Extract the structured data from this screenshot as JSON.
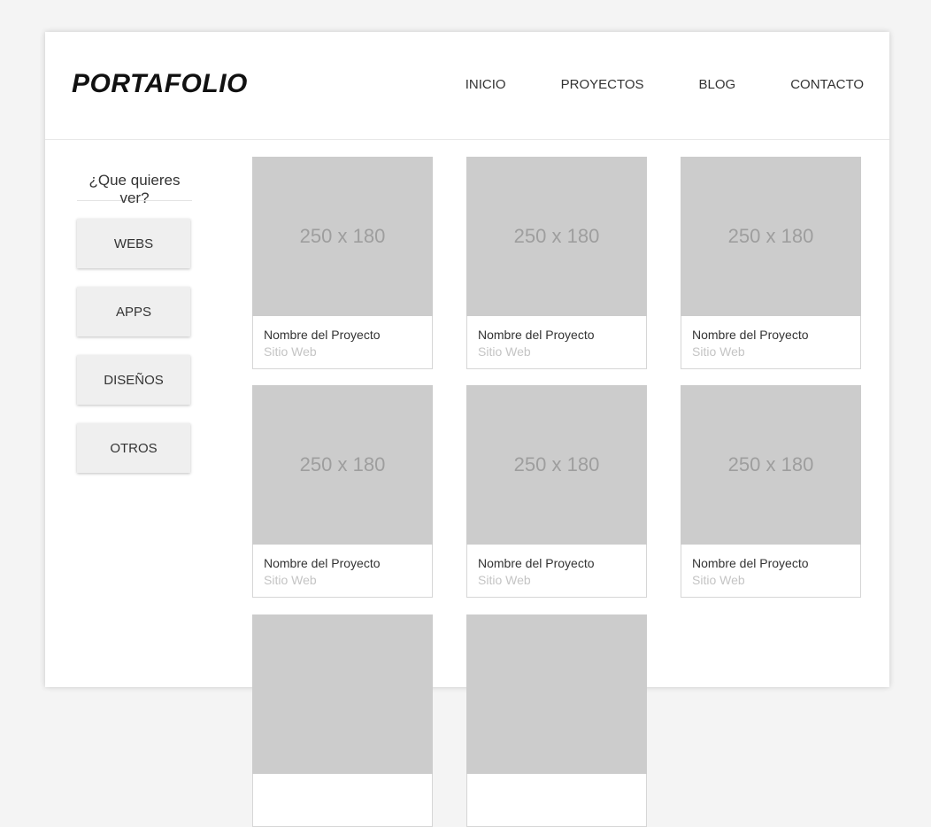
{
  "header": {
    "logo": "PORTAFOLIO",
    "nav": [
      "INICIO",
      "PROYECTOS",
      "BLOG",
      "CONTACTO"
    ]
  },
  "sidebar": {
    "title": "¿Que quieres ver?",
    "filters": [
      "WEBS",
      "APPS",
      "DISEÑOS",
      "OTROS"
    ]
  },
  "projects": [
    {
      "placeholder": "250 x 180",
      "name": "Nombre del Proyecto",
      "type": "Sitio Web"
    },
    {
      "placeholder": "250 x 180",
      "name": "Nombre del Proyecto",
      "type": "Sitio Web"
    },
    {
      "placeholder": "250 x 180",
      "name": "Nombre del Proyecto",
      "type": "Sitio Web"
    },
    {
      "placeholder": "250 x 180",
      "name": "Nombre del Proyecto",
      "type": "Sitio Web"
    },
    {
      "placeholder": "250 x 180",
      "name": "Nombre del Proyecto",
      "type": "Sitio Web"
    },
    {
      "placeholder": "250 x 180",
      "name": "Nombre del Proyecto",
      "type": "Sitio Web"
    },
    {
      "placeholder": "",
      "name": "",
      "type": ""
    },
    {
      "placeholder": "",
      "name": "",
      "type": ""
    }
  ],
  "colors": {
    "placeholder_bg": "#cccccc",
    "placeholder_text": "#9e9e9e",
    "subtitle_text": "#c4c4c4",
    "filter_bg": "#efefef"
  }
}
